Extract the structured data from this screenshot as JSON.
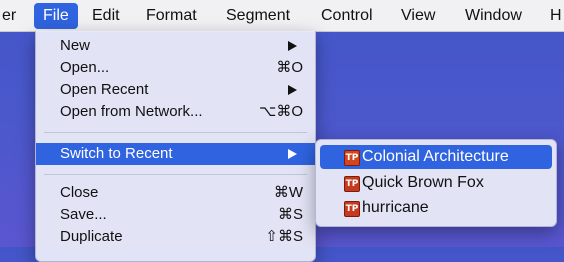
{
  "menubar": {
    "items": [
      {
        "label": "er"
      },
      {
        "label": "File"
      },
      {
        "label": "Edit"
      },
      {
        "label": "Format"
      },
      {
        "label": "Segment"
      },
      {
        "label": "Control"
      },
      {
        "label": "View"
      },
      {
        "label": "Window"
      },
      {
        "label": "H"
      }
    ]
  },
  "file_menu": {
    "items": [
      {
        "label": "New",
        "shortcut": "",
        "submenu": true
      },
      {
        "label": "Open...",
        "shortcut": "⌘O"
      },
      {
        "label": "Open Recent",
        "shortcut": "",
        "submenu": true
      },
      {
        "label": "Open from Network...",
        "shortcut": "⌥⌘O"
      },
      {
        "label": "Switch to Recent",
        "shortcut": "",
        "submenu": true,
        "highlighted": true
      },
      {
        "label": "Close",
        "shortcut": "⌘W"
      },
      {
        "label": "Save...",
        "shortcut": "⌘S"
      },
      {
        "label": "Duplicate",
        "shortcut": "⇧⌘S"
      }
    ]
  },
  "recent_submenu": {
    "icon": "tp-app-icon",
    "icon_text": "TP",
    "items": [
      {
        "label": "Colonial Architecture",
        "highlighted": true
      },
      {
        "label": "Quick Brown Fox"
      },
      {
        "label": "hurricane"
      }
    ]
  },
  "colors": {
    "accent": "#2f63df",
    "desktop": "#4a58cc",
    "menu_bg": "#e8eaf8"
  }
}
